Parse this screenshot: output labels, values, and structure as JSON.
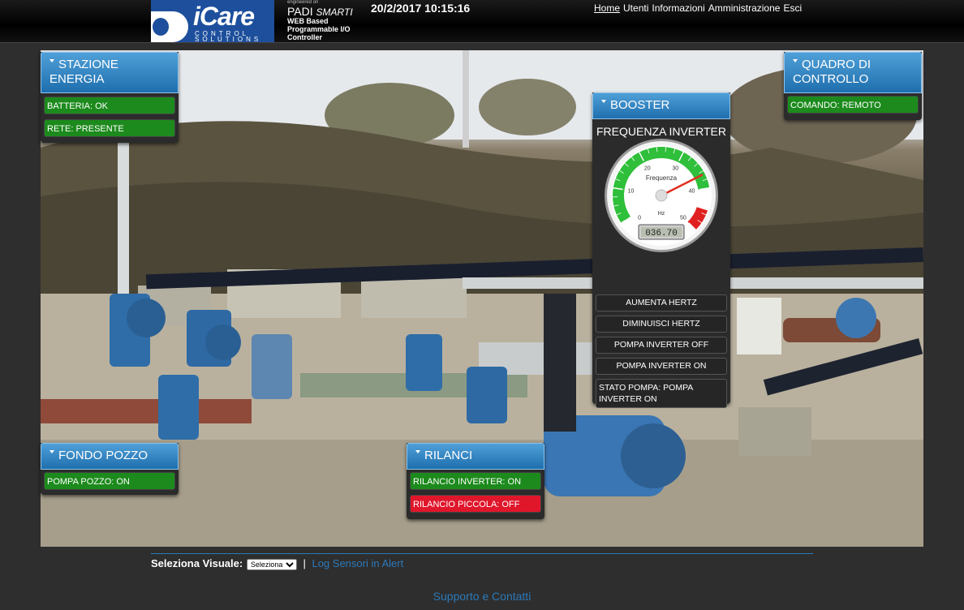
{
  "header": {
    "logo_text": "iCare",
    "logo_sub": "CONTROL SOLUTIONS",
    "engineered": "engineered on",
    "padi_name": "PADI",
    "padi_suffix": "SMARTI",
    "padi_desc": "WEB Based Programmable I/O Controller",
    "datetime": "20/2/2017 10:15:16",
    "nav": [
      "Home",
      "Utenti",
      "Informazioni",
      "Amministrazione",
      "Esci"
    ]
  },
  "panels": {
    "stazione_energia": {
      "title": "STAZIONE ENERGIA",
      "items": [
        "BATTERIA: OK",
        "RETE: PRESENTE"
      ]
    },
    "quadro_controllo": {
      "title": "QUADRO DI CONTROLLO",
      "items": [
        "COMANDO: REMOTO"
      ]
    },
    "booster": {
      "title": "BOOSTER",
      "gauge_title": "FREQUENZA INVERTER",
      "gauge": {
        "label": "Frequenza",
        "unit": "Hz",
        "value": 36.7,
        "display": "036.70",
        "ticks": [
          "0",
          "10",
          "20",
          "30",
          "40",
          "50"
        ],
        "colors": {
          "green": "#2fbf3a",
          "red": "#e02020",
          "needle": "#e03020"
        }
      },
      "buttons": [
        "AUMENTA HERTZ",
        "DIMINUISCI HERTZ",
        "POMPA INVERTER OFF",
        "POMPA INVERTER ON"
      ],
      "state": "STATO POMPA: POMPA INVERTER ON"
    },
    "fondo_pozzo": {
      "title": "FONDO POZZO",
      "items": [
        "POMPA POZZO: ON"
      ]
    },
    "rilanci": {
      "title": "RILANCI",
      "items": [
        "RILANCIO INVERTER: ON",
        "RILANCIO PICCOLA: OFF"
      ]
    }
  },
  "status_colors": {
    "ok": "#1c8a1c",
    "off": "#e0162b"
  },
  "footer": {
    "select_label": "Seleziona Visuale:",
    "select_value": "Seleziona",
    "separator": "|",
    "log_link": "Log Sensori in Alert",
    "support": "Supporto e Contatti"
  }
}
